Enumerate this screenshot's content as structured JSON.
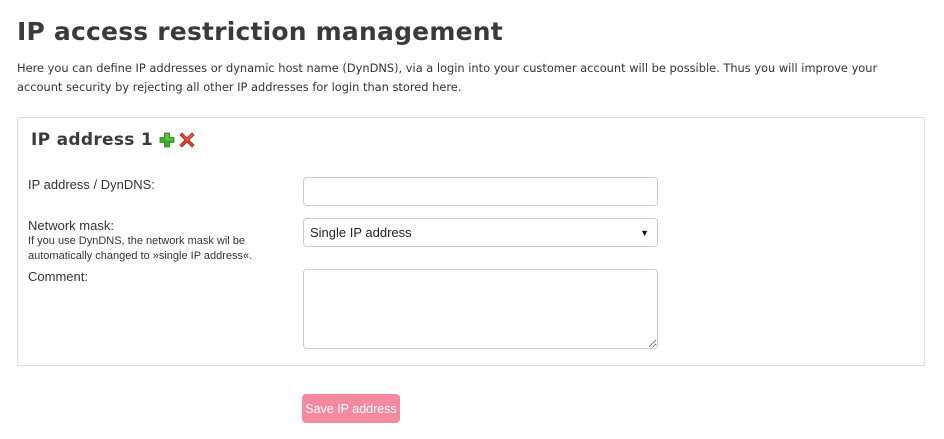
{
  "page": {
    "title": "IP access restriction management",
    "intro": "Here you can define IP addresses or dynamic host name (DynDNS), via a login into your customer account will be possible. Thus you will improve your account security by rejecting all other IP addresses for login than stored here."
  },
  "panel": {
    "title": "IP address 1",
    "add_icon": "plus-icon",
    "remove_icon": "close-icon",
    "add_icon_color": "#3fae2a",
    "remove_icon_color": "#e2422b"
  },
  "form": {
    "ip_label": "IP address / DynDNS:",
    "ip_value": "",
    "mask_label": "Network mask:",
    "mask_hint": "If you use DynDNS, the network mask wil be automatically changed to »single IP address«.",
    "mask_value": "Single IP address",
    "comment_label": "Comment:",
    "comment_value": ""
  },
  "actions": {
    "save_label": "Save IP address",
    "save_color": "#f5899f"
  }
}
